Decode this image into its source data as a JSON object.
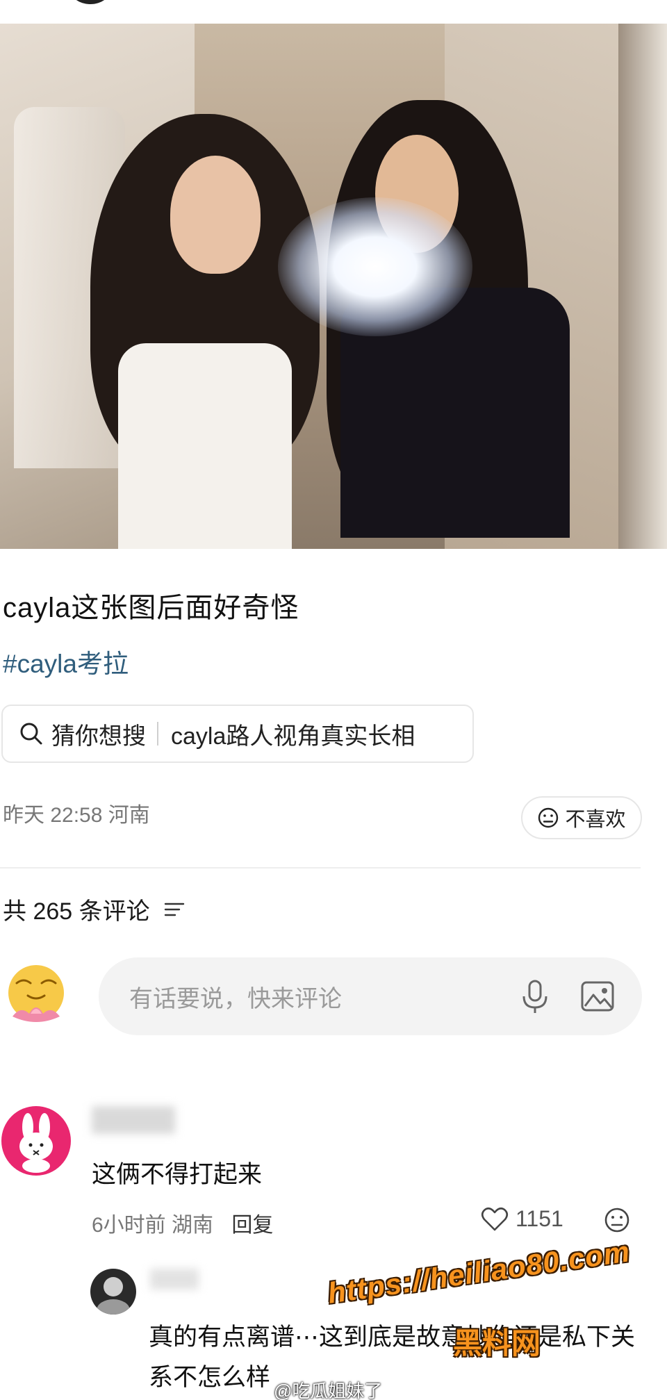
{
  "post": {
    "title": "cayla这张图后面好奇怪",
    "hashtag": "#cayla考拉",
    "search_chip": {
      "prefix": "猜你想搜",
      "query": "cayla路人视角真实长相"
    },
    "meta": "昨天 22:58 河南",
    "dislike_label": "不喜欢"
  },
  "comments_header": {
    "count_label": "共 265 条评论"
  },
  "composer": {
    "placeholder": "有话要说，快来评论"
  },
  "comments": [
    {
      "text": "这俩不得打起来",
      "meta": "6小时前 湖南",
      "reply_label": "回复",
      "likes": "1151"
    },
    {
      "text": "真的有点离谱⋯这到底是故意炒作还是私下关系不怎么样"
    }
  ],
  "watermarks": {
    "url": "https://heiliao80.com",
    "site_name": "黑料网",
    "weibo": "@吃瓜姐妹了"
  },
  "colors": {
    "hashtag": "#2f5d7c",
    "watermark": "#f7931e",
    "avatar_pink": "#e9276f"
  }
}
